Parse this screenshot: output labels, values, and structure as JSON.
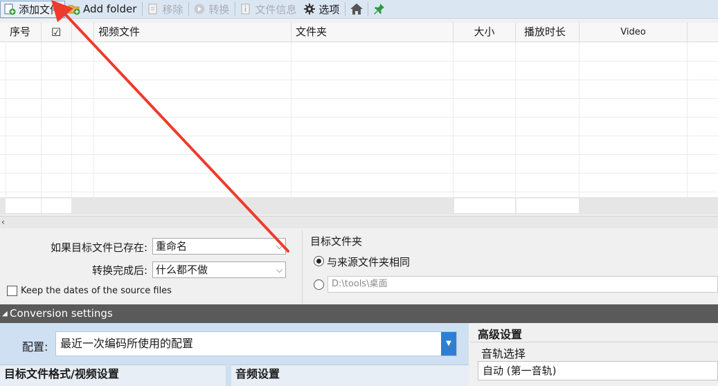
{
  "toolbar": {
    "add_file": "添加文件",
    "add_folder": "Add folder",
    "remove": "移除",
    "convert": "转换",
    "file_info": "文件信息",
    "options": "选项"
  },
  "grid": {
    "columns": [
      "序号",
      "☑",
      "视频文件",
      "文件夹",
      "大小",
      "播放时长",
      "Video"
    ]
  },
  "options": {
    "if_exists_label": "如果目标文件已存在:",
    "if_exists_value": "重命名",
    "after_convert_label": "转换完成后:",
    "after_convert_value": "什么都不做",
    "keep_dates_label": "Keep the dates of the source files",
    "target_folder_title": "目标文件夹",
    "same_as_source_label": "与来源文件夹相同",
    "custom_path": "D:\\tools\\桌面"
  },
  "conversion": {
    "bar_title": "Conversion settings",
    "profile_label": "配置:",
    "profile_value": "最近一次编码所使用的配置",
    "format_video_title": "目标文件格式/视频设置",
    "audio_title": "音频设置",
    "advanced_title": "高级设置",
    "audio_track_label": "音轨选择",
    "audio_track_value": "自动 (第一音轨)"
  },
  "colors": {
    "toolbar_bg": "#dbe6f3",
    "conv_bar_bg": "#5a5a5a",
    "accent_blue": "#2f7fd1",
    "annotation_red": "#ee3b2b"
  }
}
